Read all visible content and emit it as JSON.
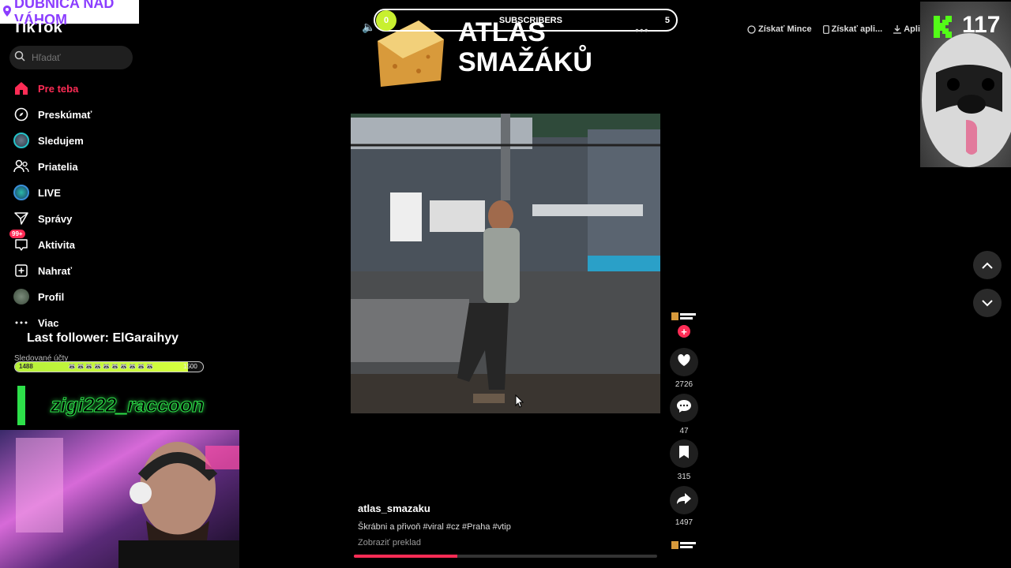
{
  "overlay": {
    "location": "DUBNICA NAD VÁHOM",
    "last_follower": "Last follower: ElGaraihyy",
    "followed_label": "Sledované účty",
    "goal_left": "1488",
    "goal_right": "1500",
    "goal_fraction": 0.92,
    "cam_name": "zigi222_raccoon",
    "subscribers_label": "SUBSCRIBERS",
    "subscribers_start": "0",
    "subscribers_end": "5",
    "kick_count": "117"
  },
  "app": {
    "logo": "TikTok"
  },
  "search": {
    "placeholder": "Hľadať"
  },
  "sidebar": {
    "items": [
      {
        "label": "Pre teba",
        "icon": "home-icon"
      },
      {
        "label": "Preskúmať",
        "icon": "compass-icon"
      },
      {
        "label": "Sledujem",
        "icon": "following-avatar-icon"
      },
      {
        "label": "Priatelia",
        "icon": "friends-icon"
      },
      {
        "label": "LIVE",
        "icon": "live-avatar-icon"
      },
      {
        "label": "Správy",
        "icon": "messages-icon"
      },
      {
        "label": "Aktivita",
        "icon": "activity-icon",
        "badge": "99+"
      },
      {
        "label": "Nahrať",
        "icon": "upload-icon"
      },
      {
        "label": "Profil",
        "icon": "profile-avatar-icon"
      },
      {
        "label": "Viac",
        "icon": "more-icon"
      }
    ]
  },
  "brand": {
    "line1": "ATLAS",
    "line2": "SMAŽÁKŮ"
  },
  "video": {
    "author": "atlas_smazaku",
    "caption": "Škrábni a přivoň #viral #cz #Praha #vtip",
    "translate": "Zobraziť preklad",
    "progress": 0.34
  },
  "actions": {
    "likes": "2726",
    "comments": "47",
    "saves": "315",
    "shares": "1497"
  },
  "header": {
    "coins": "Získať Mince",
    "app": "Získať apli...",
    "download": "Apli"
  },
  "colors": {
    "accent": "#fe2c55",
    "overlay_green": "#2de04a"
  }
}
